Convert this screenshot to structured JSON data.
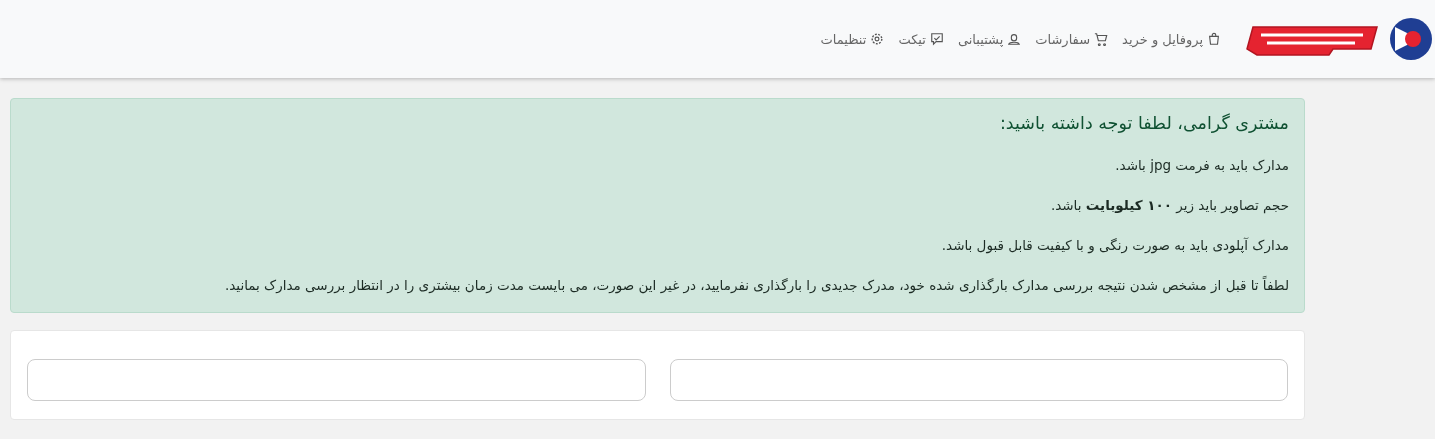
{
  "header": {
    "nav": [
      {
        "label": "پروفایل و خرید",
        "kind": "bag"
      },
      {
        "label": "سفارشات",
        "kind": "cart"
      },
      {
        "label": "پشتیبانی",
        "kind": "support"
      },
      {
        "label": "تیکت",
        "kind": "ticket"
      },
      {
        "label": "تنظیمات",
        "kind": "gear"
      }
    ]
  },
  "alert": {
    "title": "مشتری گرامی، لطفا توجه داشته باشید:",
    "items": [
      "مدارک باید به فرمت jpg باشد.",
      "حجم تصاویر باید زیر **۱۰۰ کیلوبایت** باشد.",
      "مدارک آپلودی باید به صورت رنگی و با کیفیت قابل قبول باشد.",
      "لطفاً تا قبل از مشخص شدن نتیجه بررسی مدارک بارگذاری شده خود، مدرک جدیدی را بارگذاری نفرمایید، در غیر این صورت، می بایست مدت زمان بیشتری را در انتظار بررسی مدارک بمانید."
    ]
  }
}
